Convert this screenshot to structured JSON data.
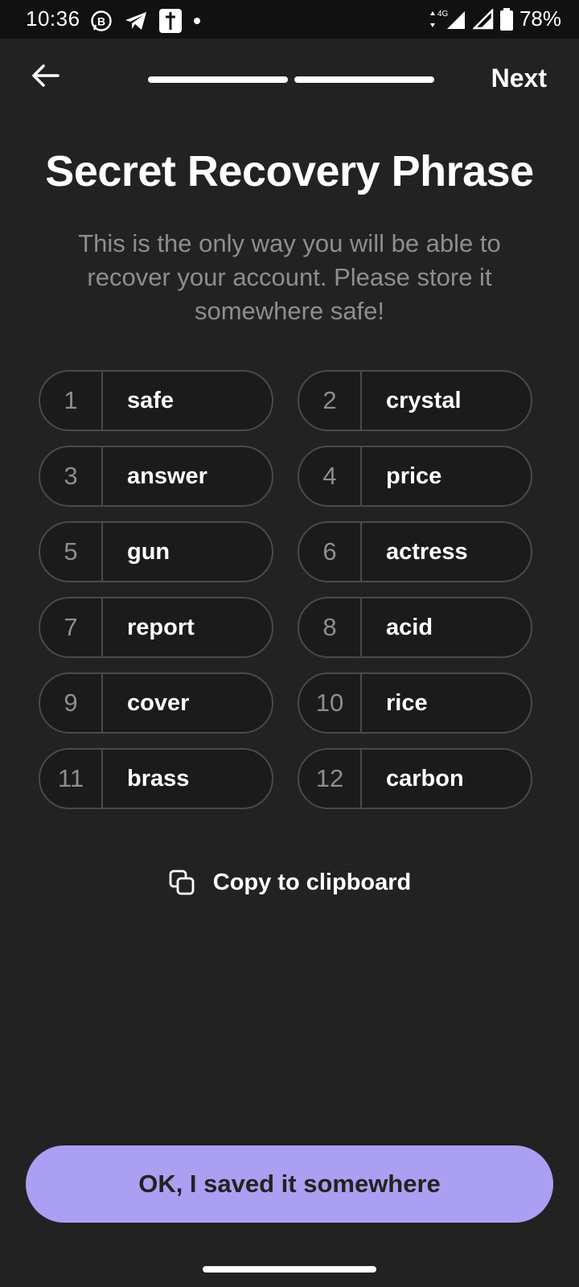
{
  "status_bar": {
    "time": "10:36",
    "network": "4G",
    "battery": "78%"
  },
  "header": {
    "next_label": "Next",
    "progress_steps": 2,
    "progress_current": 2
  },
  "title": "Secret Recovery Phrase",
  "subtitle": "This is the only way you will be able to recover your account. Please store it somewhere safe!",
  "words": [
    {
      "num": "1",
      "word": "safe"
    },
    {
      "num": "2",
      "word": "crystal"
    },
    {
      "num": "3",
      "word": "answer"
    },
    {
      "num": "4",
      "word": "price"
    },
    {
      "num": "5",
      "word": "gun"
    },
    {
      "num": "6",
      "word": "actress"
    },
    {
      "num": "7",
      "word": "report"
    },
    {
      "num": "8",
      "word": "acid"
    },
    {
      "num": "9",
      "word": "cover"
    },
    {
      "num": "10",
      "word": "rice"
    },
    {
      "num": "11",
      "word": "brass"
    },
    {
      "num": "12",
      "word": "carbon"
    }
  ],
  "copy_label": "Copy to clipboard",
  "confirm_button": "OK, I saved it somewhere",
  "colors": {
    "background": "#222222",
    "accent": "#ab9ff2",
    "muted_text": "#8e8e8e"
  },
  "icons": [
    "whatsapp-business-icon",
    "telegram-icon",
    "cross-app-icon",
    "signal-icon",
    "battery-icon",
    "back-arrow-icon",
    "copy-icon"
  ]
}
